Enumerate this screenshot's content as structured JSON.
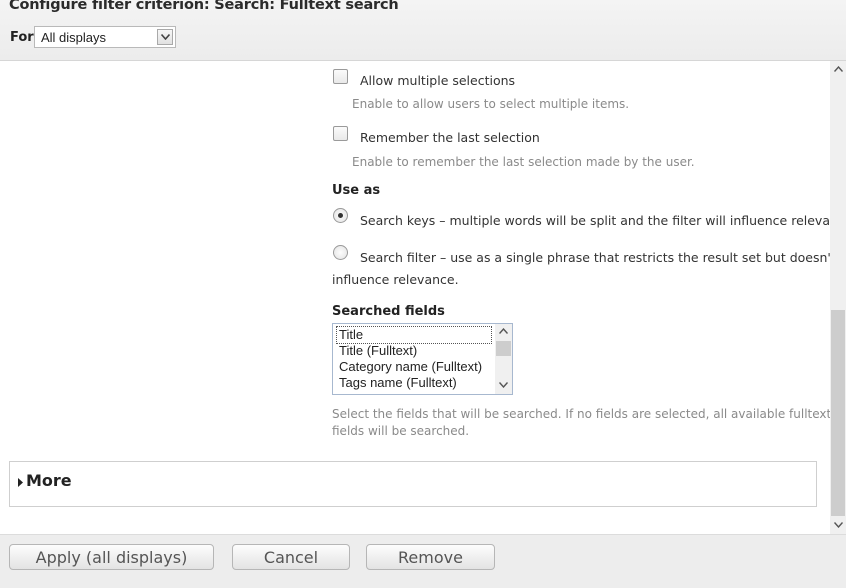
{
  "header": {
    "title": "Configure filter criterion: Search: Fulltext search",
    "for_label": "For",
    "for_select_value": "All displays"
  },
  "options": {
    "allow_multiple": {
      "label": "Allow multiple selections",
      "description": "Enable to allow users to select multiple items.",
      "checked": false
    },
    "remember_last": {
      "label": "Remember the last selection",
      "description": "Enable to remember the last selection made by the user.",
      "checked": false
    }
  },
  "use_as": {
    "heading": "Use as",
    "option1": "Search keys – multiple words will be split and the filter will influence relevance.",
    "option2_line1": "Search filter – use as a single phrase that restricts the result set but doesn't",
    "option2_line2": "influence relevance.",
    "selected": "option1"
  },
  "searched_fields": {
    "heading": "Searched fields",
    "items": [
      "Title",
      "Title (Fulltext)",
      "Category name (Fulltext)",
      "Tags name (Fulltext)"
    ],
    "description_line1": "Select the fields that will be searched. If no fields are selected, all available fulltext",
    "description_line2": "fields will be searched."
  },
  "more": {
    "label": "More"
  },
  "footer": {
    "apply_label": "Apply (all displays)",
    "cancel_label": "Cancel",
    "remove_label": "Remove"
  },
  "icons": {
    "select_arrow": "chevron-down-icon",
    "scroll_up": "scroll-up-arrow-icon",
    "scroll_down": "scroll-down-arrow-icon",
    "more_caret": "caret-right-icon"
  }
}
